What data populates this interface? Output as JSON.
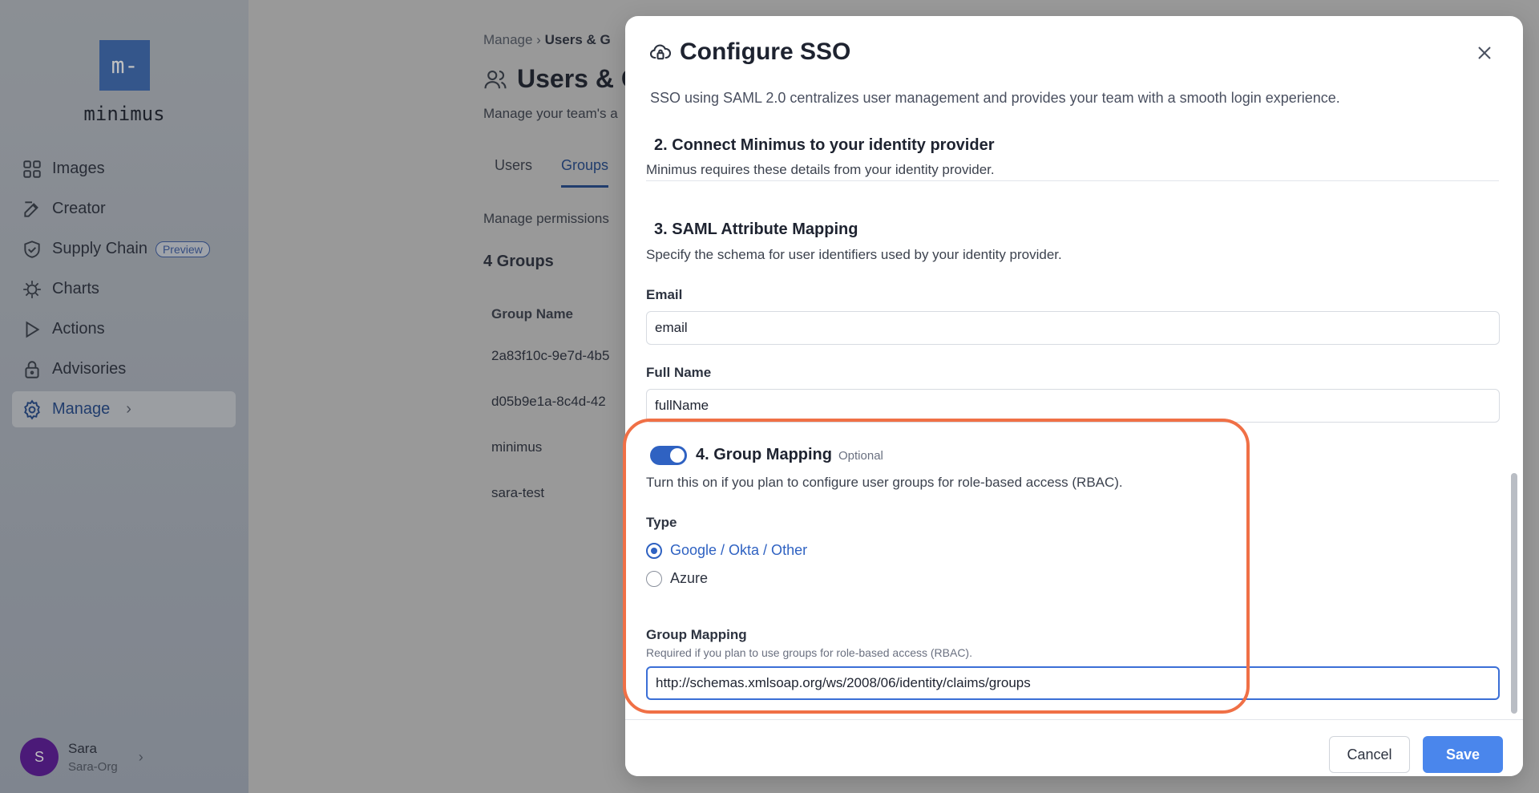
{
  "sidebar": {
    "logo_mark": "m-",
    "logo_text": "minimus",
    "items": [
      {
        "label": "Images",
        "icon": "grid-icon"
      },
      {
        "label": "Creator",
        "icon": "edit-icon"
      },
      {
        "label": "Supply Chain",
        "icon": "shield-icon",
        "badge": "Preview"
      },
      {
        "label": "Charts",
        "icon": "helm-icon"
      },
      {
        "label": "Actions",
        "icon": "play-icon"
      },
      {
        "label": "Advisories",
        "icon": "lock-icon"
      },
      {
        "label": "Manage",
        "icon": "gear-icon",
        "active": true
      }
    ],
    "user": {
      "initial": "S",
      "name": "Sara",
      "org": "Sara-Org"
    }
  },
  "page": {
    "breadcrumb_root": "Manage",
    "breadcrumb_current": "Users & G",
    "title": "Users & G",
    "description": "Manage your team's a",
    "tabs": [
      "Users",
      "Groups"
    ],
    "permissions_desc": "Manage permissions",
    "groups_count": "4 Groups",
    "column_group_name": "Group Name",
    "groups": [
      "2a83f10c-9e7d-4b5",
      "d05b9e1a-8c4d-42",
      "minimus",
      "sara-test"
    ]
  },
  "modal": {
    "title": "Configure SSO",
    "subtitle": "SSO using SAML 2.0 centralizes user management and provides your team with a smooth login experience.",
    "section2_title": "2. Connect Minimus to your identity provider",
    "section2_desc": "Minimus requires these details from your identity provider.",
    "section3_title": "3. SAML Attribute Mapping",
    "section3_desc": "Specify the schema for user identifiers used by your identity provider.",
    "email_label": "Email",
    "email_value": "email",
    "fullname_label": "Full Name",
    "fullname_value": "fullName",
    "section4_title": "4. Group Mapping",
    "section4_optional": "Optional",
    "section4_desc": "Turn this on if you plan to configure user groups for role-based access (RBAC).",
    "type_label": "Type",
    "type_options": [
      "Google / Okta / Other",
      "Azure"
    ],
    "group_mapping_label": "Group Mapping",
    "group_mapping_hint": "Required if you plan to use groups for role-based access (RBAC).",
    "group_mapping_value": "http://schemas.xmlsoap.org/ws/2008/06/identity/claims/groups",
    "cancel_label": "Cancel",
    "save_label": "Save"
  },
  "colors": {
    "accent": "#2f62c2",
    "save_button": "#4a86ec",
    "highlight": "#f07046",
    "logo_bg": "#3d6db6",
    "avatar": "#5d1a9c"
  }
}
